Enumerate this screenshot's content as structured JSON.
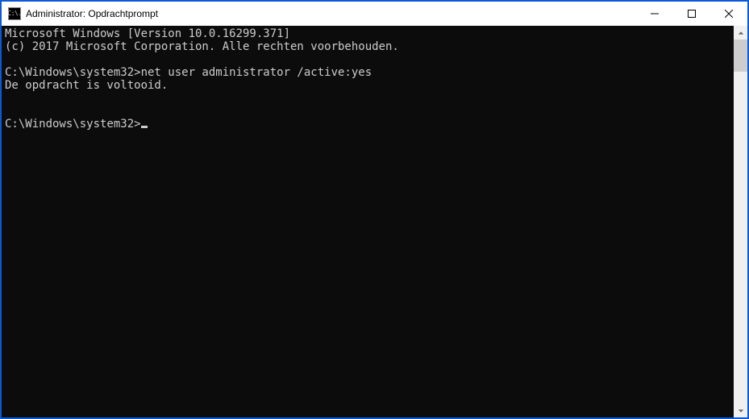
{
  "window": {
    "title": "Administrator: Opdrachtprompt",
    "icon_text": "C:\\."
  },
  "terminal": {
    "lines": [
      "Microsoft Windows [Version 10.0.16299.371]",
      "(c) 2017 Microsoft Corporation. Alle rechten voorbehouden.",
      "",
      "C:\\Windows\\system32>net user administrator /active:yes",
      "De opdracht is voltooid.",
      "",
      "",
      "C:\\Windows\\system32>"
    ]
  }
}
